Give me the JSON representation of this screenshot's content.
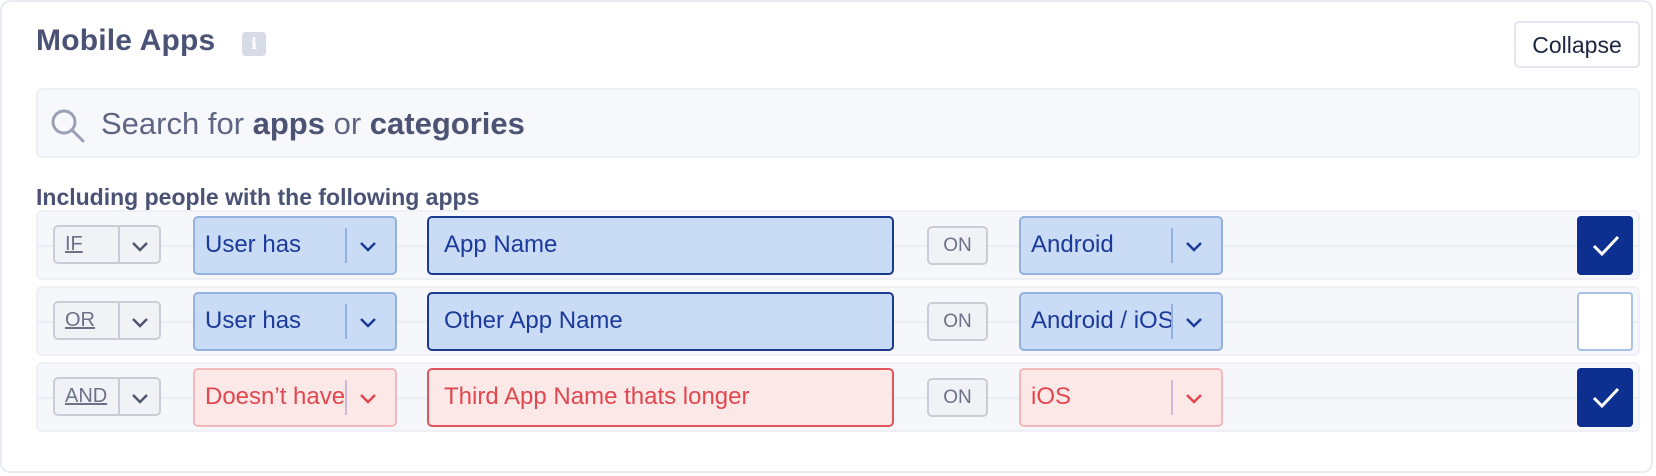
{
  "header": {
    "title": "Mobile Apps",
    "info_icon": "info-icon",
    "collapse_label": "Collapse"
  },
  "search": {
    "icon": "search-icon",
    "prefix": "Search for ",
    "term1": "apps",
    "middle": " or ",
    "term2": "categories"
  },
  "section": {
    "label": "Including people with the following apps"
  },
  "rules": [
    {
      "operator": "IF",
      "condition": "User has",
      "app": "App Name",
      "on_label": "ON",
      "platform": "Android",
      "checked": true,
      "variant": "include"
    },
    {
      "operator": "OR",
      "condition": "User has",
      "app": "Other App Name",
      "on_label": "ON",
      "platform": "Android / iOS",
      "checked": false,
      "variant": "include"
    },
    {
      "operator": "AND",
      "condition": "Doesn’t have",
      "app": "Third App Name thats longer",
      "on_label": "ON",
      "platform": "iOS",
      "checked": true,
      "variant": "exclude"
    }
  ],
  "colors": {
    "accent": "#0d2f8f",
    "include_fill": "#cadcf5",
    "exclude_fill": "#fde8e8",
    "exclude_text": "#e1474f"
  }
}
